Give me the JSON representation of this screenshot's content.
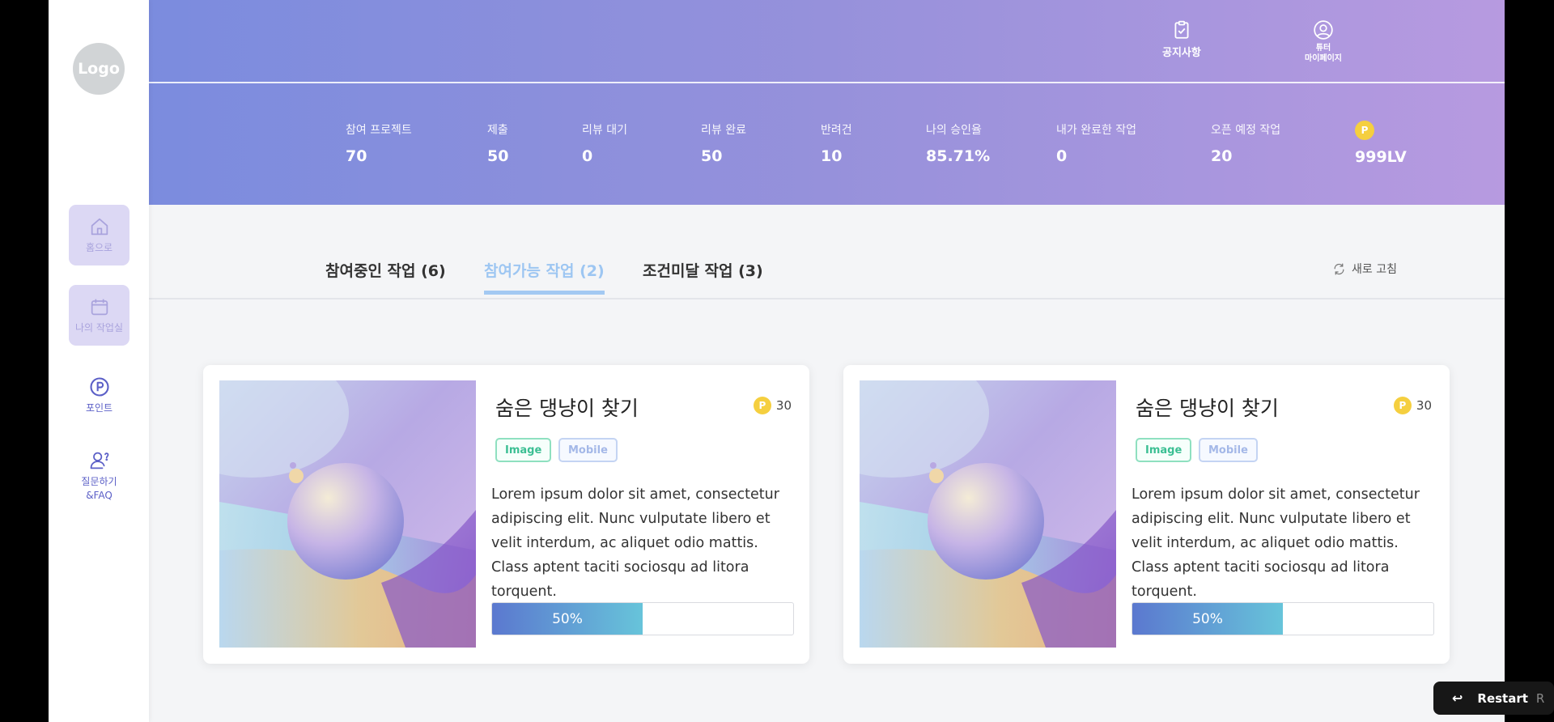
{
  "sidebar": {
    "logo": "Logo",
    "items": [
      {
        "label": "홈으로",
        "icon": "home-icon"
      },
      {
        "label": "나의 작업실",
        "icon": "calendar-icon"
      },
      {
        "label": "포인트",
        "icon": "points-icon"
      },
      {
        "label": "질문하기\n&FAQ",
        "icon": "user-question-icon"
      }
    ]
  },
  "header": {
    "notice_label": "공지사항",
    "mypage_label": "튜터\n마이페이지"
  },
  "stats": [
    {
      "label": "참여 프로젝트",
      "value": "70"
    },
    {
      "label": "제출",
      "value": "50"
    },
    {
      "label": "리뷰 대기",
      "value": "0"
    },
    {
      "label": "리뷰 완료",
      "value": "50"
    },
    {
      "label": "반려건",
      "value": "10"
    },
    {
      "label": "나의 승인율",
      "value": "85.71%"
    },
    {
      "label": "내가 완료한 작업",
      "value": "0"
    },
    {
      "label": "오픈 예정 작업",
      "value": "20"
    },
    {
      "coin": "P",
      "value": "999LV"
    }
  ],
  "tabs": [
    {
      "label": "참여중인 작업 (6)"
    },
    {
      "label": "참여가능 작업 (2)",
      "active": true
    },
    {
      "label": "조건미달 작업 (3)"
    }
  ],
  "refresh_label": "새로 고침",
  "cards": [
    {
      "title": "숨은 댕냥이 찾기",
      "coin": "P",
      "points": "30",
      "tags": [
        "Image",
        "Mobile"
      ],
      "description": "Lorem ipsum dolor sit amet, consectetur adipiscing elit. Nunc vulputate libero et velit interdum, ac aliquet odio mattis. Class aptent taciti sociosqu ad litora torquent.",
      "progress_label": "50%",
      "progress": 0.5
    },
    {
      "title": "숨은 댕냥이 찾기",
      "coin": "P",
      "points": "30",
      "tags": [
        "Image",
        "Mobile"
      ],
      "description": "Lorem ipsum dolor sit amet, consectetur adipiscing elit. Nunc vulputate libero et velit interdum, ac aliquet odio mattis. Class aptent taciti sociosqu ad litora torquent.",
      "progress_label": "50%",
      "progress": 0.5
    }
  ],
  "restart": {
    "label": "Restart",
    "key": "R"
  },
  "colors": {
    "header_start": "#7b8cde",
    "header_end": "#b79ae0",
    "active_tab": "#9dc6f2",
    "coin": "#f5cf3f",
    "tag_image": "#3bbf93",
    "tag_mobile": "#a4b8e8"
  }
}
